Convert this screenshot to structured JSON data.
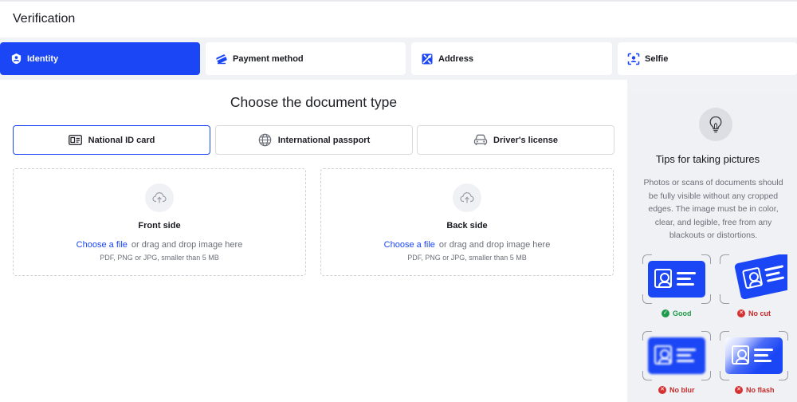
{
  "header": {
    "title": "Verification"
  },
  "steps": [
    {
      "label": "Identity",
      "icon": "identity-icon",
      "active": true
    },
    {
      "label": "Payment method",
      "icon": "card-icon",
      "active": false
    },
    {
      "label": "Address",
      "icon": "map-icon",
      "active": false
    },
    {
      "label": "Selfie",
      "icon": "face-scan-icon",
      "active": false
    }
  ],
  "main": {
    "heading": "Choose the document type",
    "doc_types": [
      {
        "label": "National ID card",
        "icon": "id-card-icon",
        "selected": true
      },
      {
        "label": "International passport",
        "icon": "globe-icon",
        "selected": false
      },
      {
        "label": "Driver's license",
        "icon": "car-icon",
        "selected": false
      }
    ],
    "upload": [
      {
        "side": "Front side",
        "choose": "Choose a file",
        "drag": "or drag and drop image here",
        "hint": "PDF, PNG or JPG, smaller than 5 MB"
      },
      {
        "side": "Back side",
        "choose": "Choose a file",
        "drag": "or drag and drop image here",
        "hint": "PDF, PNG or JPG, smaller than 5 MB"
      }
    ]
  },
  "tips": {
    "title": "Tips for taking pictures",
    "text": "Photos or scans of documents should be fully visible without any cropped edges. The image must be in color, clear, and legible, free from any blackouts or distortions.",
    "samples": [
      {
        "label": "Good",
        "status": "good"
      },
      {
        "label": "No cut",
        "status": "bad"
      },
      {
        "label": "No blur",
        "status": "bad"
      },
      {
        "label": "No flash",
        "status": "bad"
      }
    ]
  },
  "colors": {
    "accent": "#1b46f5",
    "good": "#1f9a4a",
    "bad": "#d63131"
  }
}
